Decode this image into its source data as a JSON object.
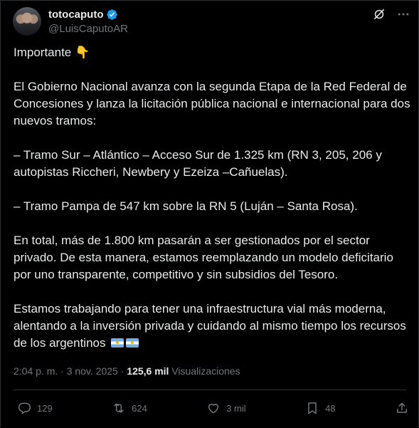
{
  "author": {
    "display_name": "totocaputo",
    "handle": "@LuisCaputoAR"
  },
  "tweet": {
    "line_1": "Importante 👇",
    "paragraph_1": "El Gobierno Nacional avanza con la segunda Etapa de la Red Federal de Concesiones y lanza la licitación pública nacional e internacional para dos nuevos tramos:",
    "paragraph_2": "– Tramo Sur – Atlántico – Acceso Sur de 1.325 km (RN 3, 205, 206 y autopistas Riccheri, Newbery y Ezeiza –Cañuelas).",
    "paragraph_3": "– Tramo Pampa de 547 km sobre la RN 5 (Luján – Santa Rosa).",
    "paragraph_4": "En total, más de 1.800 km pasarán a ser gestionados por el sector privado. De esta manera, estamos reemplazando un modelo deficitario por uno transparente, competitivo y sin subsidios del Tesoro.",
    "paragraph_5": "Estamos trabajando para tener una infraestructura vial más moderna, alentando a la inversión privada y cuidando al mismo tiempo los recursos de los argentinos"
  },
  "meta": {
    "timestamp": "2:04 p. m. · 3 nov. 2025 · ",
    "views_count": "125,6 mil",
    "views_label": " Visualizaciones"
  },
  "actions": {
    "replies": "129",
    "reposts": "624",
    "likes": "3 mil",
    "bookmarks": "48"
  },
  "colors": {
    "background": "#000000",
    "text": "#e7e9ea",
    "muted": "#71767b",
    "verified": "#1d9bf0",
    "border": "#2f3336"
  },
  "icons": [
    "verified-badge-icon",
    "grok-icon",
    "more-icon",
    "reply-icon",
    "repost-icon",
    "like-icon",
    "bookmark-icon",
    "share-icon",
    "argentina-flag-icon"
  ]
}
